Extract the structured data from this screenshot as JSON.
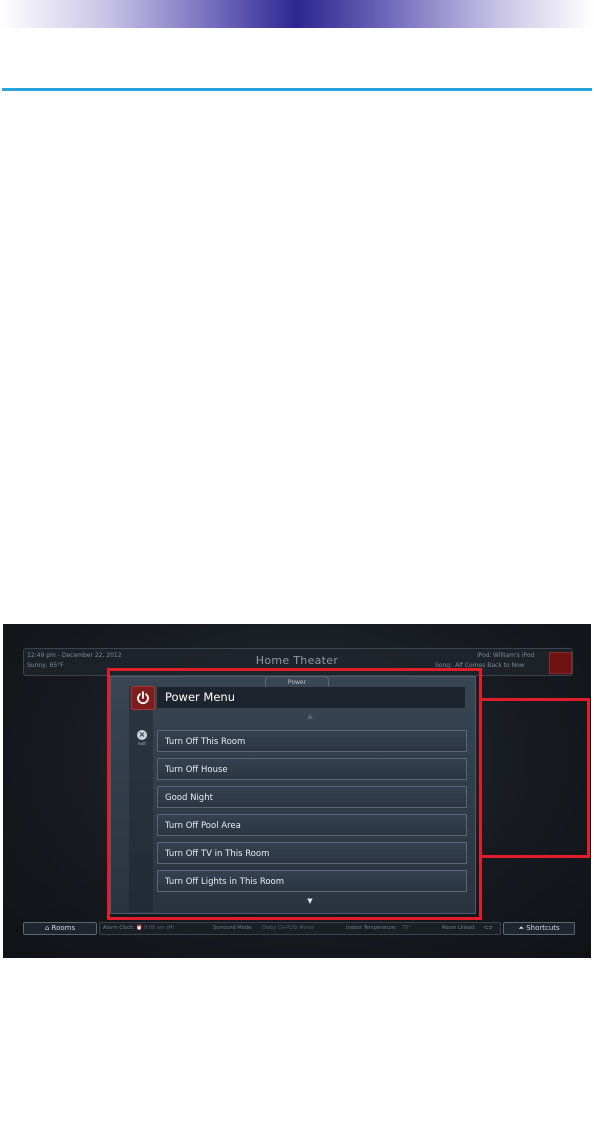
{
  "page": {
    "screen": {
      "top_left": {
        "time_date": "12:49 pm - December 22, 2012",
        "weather": "Sunny, 65°F"
      },
      "room_title": "Home Theater",
      "top_right": {
        "ipod_label": "iPod:",
        "ipod_value": "William's iPod",
        "song_label": "Song:",
        "song_value": "Alf Comes Back to Now"
      },
      "panel_tab": "Power",
      "menu_title": "Power Menu",
      "exit_label": "exit",
      "menu_items": [
        "Turn Off This Room",
        "Turn Off House",
        "Good Night",
        "Turn Off Pool Area",
        "Turn Off TV in This Room",
        "Turn Off Lights in This Room"
      ],
      "bottom": {
        "rooms_button": "Rooms",
        "alarm_label": "Alarm Clock:",
        "alarm_value": "9:00 am (M)",
        "surround_label": "Surround Mode:",
        "surround_value": "Dolby D+PLIIx Movie",
        "indoor_label": "Indoor Temperature:",
        "indoor_value": "75°",
        "room_linked_label": "Room Linked:",
        "shortcuts_button": "Shortcuts"
      }
    },
    "icons": [
      "power-icon",
      "exit-icon",
      "scroll-up-icon",
      "scroll-down-icon",
      "rooms-icon",
      "shortcuts-icon",
      "alarm-icon",
      "link-icon"
    ],
    "colors": {
      "highlight_box": "#e21d2b",
      "rule": "#29a3dc",
      "power_button": "#7d1d1d"
    }
  }
}
